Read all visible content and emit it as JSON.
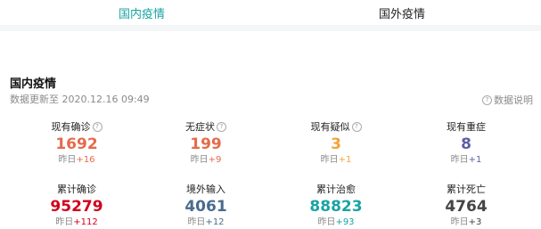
{
  "tabs": [
    {
      "label": "国内疫情"
    },
    {
      "label": "国外疫情"
    }
  ],
  "section": {
    "title": "国内疫情",
    "update_time": "数据更新至 2020.12.16 09:49",
    "explain_label": "数据说明"
  },
  "stats": [
    {
      "label": "现有确诊",
      "value": "1692",
      "delta_prefix": "昨日",
      "delta": "+16",
      "color": "#e46b4c",
      "delta_color": "#e46b4c"
    },
    {
      "label": "无症状",
      "value": "199",
      "delta_prefix": "昨日",
      "delta": "+9",
      "color": "#e46b4c",
      "delta_color": "#e46b4c"
    },
    {
      "label": "现有疑似",
      "value": "3",
      "delta_prefix": "昨日",
      "delta": "+1",
      "color": "#f2a33a",
      "delta_color": "#f2a33a"
    },
    {
      "label": "现有重症",
      "value": "8",
      "delta_prefix": "昨日",
      "delta": "+1",
      "color": "#5b5fa2",
      "delta_color": "#5b5fa2"
    },
    {
      "label": "累计确诊",
      "value": "95279",
      "delta_prefix": "昨日",
      "delta": "+112",
      "color": "#d0021b",
      "delta_color": "#d0021b"
    },
    {
      "label": "境外输入",
      "value": "4061",
      "delta_prefix": "昨日",
      "delta": "+12",
      "color": "#4a6b8c",
      "delta_color": "#4a6b8c"
    },
    {
      "label": "累计治愈",
      "value": "88823",
      "delta_prefix": "昨日",
      "delta": "+93",
      "color": "#1aa3a3",
      "delta_color": "#1aa3a3"
    },
    {
      "label": "累计死亡",
      "value": "4764",
      "delta_prefix": "昨日",
      "delta": "+3",
      "color": "#444444",
      "delta_color": "#444444"
    }
  ],
  "help_icon_glyph": "?"
}
